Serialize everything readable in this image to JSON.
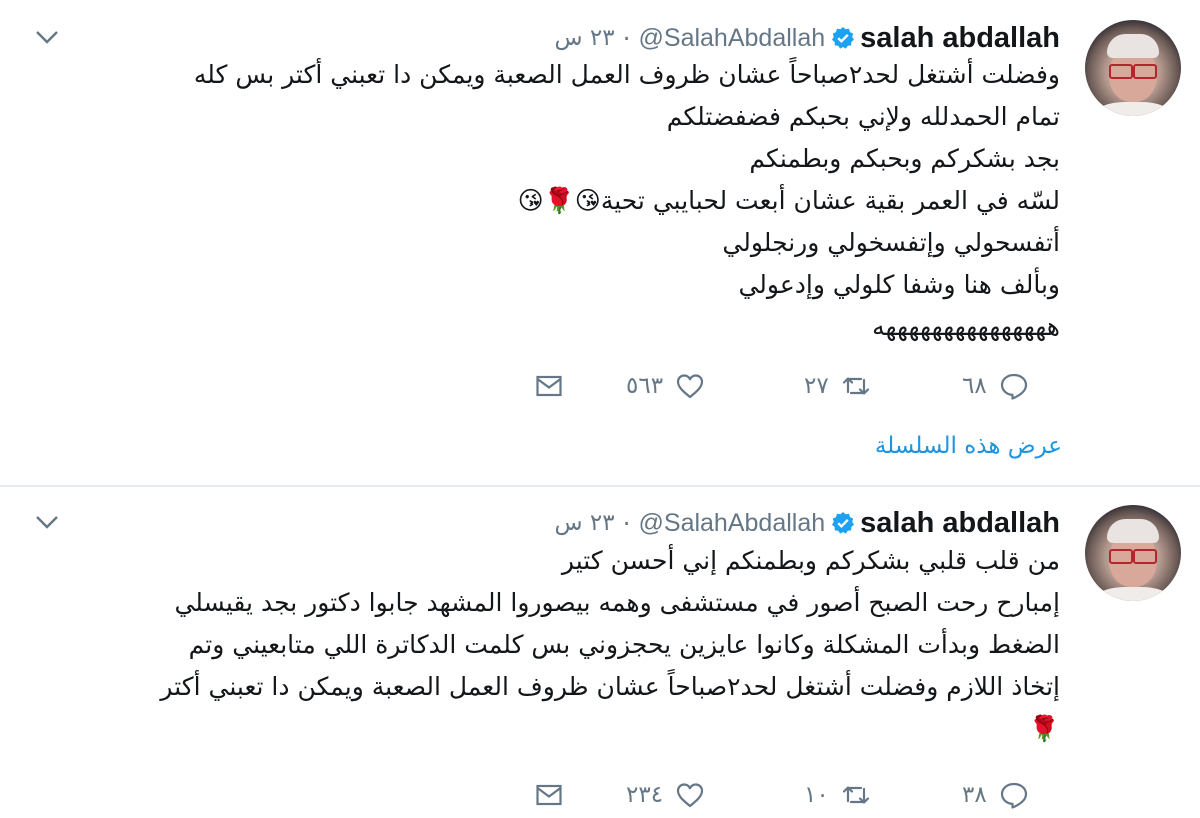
{
  "tweets": [
    {
      "author_name": "salah abdallah",
      "handle": "@SalahAbdallah",
      "separator": "·",
      "time": "٢٣ س",
      "lines": [
        "وفضلت أشتغل لحد٢صباحاً عشان ظروف العمل الصعبة ويمكن دا تعبني أكتر بس كله",
        "تمام الحمدلله ولإني بحبكم فضفضتلكم",
        "بجد بشكركم وبحبكم وبطمنكم",
        "لسّه في العمر بقية عشان أبعت لحبايبي تحية😘🌹😘",
        "أتفسحولي وإتفسخولي ورنجلولي",
        "وبألف هنا وشفا كلولي وإدعولي",
        "هههههههههههههههه"
      ],
      "replies": "٦٨",
      "retweets": "٢٧",
      "likes": "٥٦٣",
      "thread_link": "عرض هذه السلسلة"
    },
    {
      "author_name": "salah abdallah",
      "handle": "@SalahAbdallah",
      "separator": "·",
      "time": "٢٣ س",
      "lines": [
        "من قلب قلبي بشكركم وبطمنكم إني أحسن كتير",
        "إمبارح رحت الصبح أصور في مستشفى وهمه بيصوروا المشهد جابوا دكتور بجد يقيسلي",
        "الضغط وبدأت المشكلة وكانوا عايزين يحجزوني بس كلمت الدكاترة اللي متابعيني وتم",
        "إتخاذ اللازم وفضلت أشتغل لحد٢صباحاً عشان ظروف العمل الصعبة ويمكن دا تعبني أكتر",
        "🌹"
      ],
      "replies": "٣٨",
      "retweets": "١٠",
      "likes": "٢٣٤"
    }
  ],
  "icons": {
    "caret": "chevron-down-icon",
    "verified": "verified-badge-icon",
    "reply": "reply-icon",
    "retweet": "retweet-icon",
    "like": "heart-icon",
    "dm": "envelope-icon"
  },
  "colors": {
    "link": "#1b95e0",
    "muted": "#657786",
    "text": "#14171a",
    "verified": "#1da1f2"
  }
}
